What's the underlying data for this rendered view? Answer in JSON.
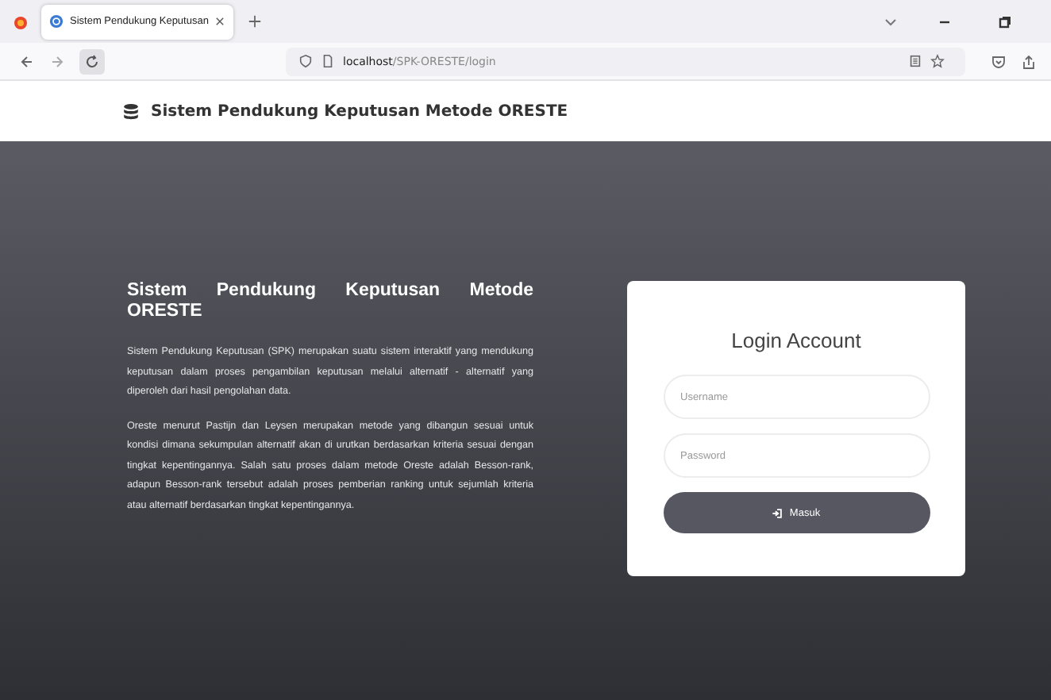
{
  "browser": {
    "tab": {
      "title": "Sistem Pendukung Keputusan",
      "selected": true
    },
    "address": {
      "host": "localhost",
      "path": "/SPK-ORESTE/login"
    }
  },
  "header": {
    "title": "Sistem Pendukung Keputusan Metode ORESTE"
  },
  "intro": {
    "heading": "Sistem Pendukung Keputusan Metode ORESTE",
    "paragraphs": [
      "Sistem Pendukung Keputusan (SPK) merupakan suatu sistem interaktif yang mendukung keputusan dalam proses pengambilan keputusan melalui alternatif - alternatif yang diperoleh dari hasil pengolahan data.",
      "Oreste menurut Pastijn dan Leysen merupakan metode yang dibangun sesuai untuk kondisi dimana sekumpulan alternatif akan di urutkan berdasarkan kriteria sesuai dengan tingkat kepentingannya. Salah satu proses dalam metode Oreste adalah Besson-rank, adapun Besson-rank tersebut adalah proses pemberian ranking untuk sejumlah kriteria atau alternatif berdasarkan tingkat kepentingannya."
    ]
  },
  "login": {
    "title": "Login Account",
    "fields": [
      {
        "placeholder": "Username"
      },
      {
        "placeholder": "Password"
      }
    ],
    "button": "Masuk"
  }
}
